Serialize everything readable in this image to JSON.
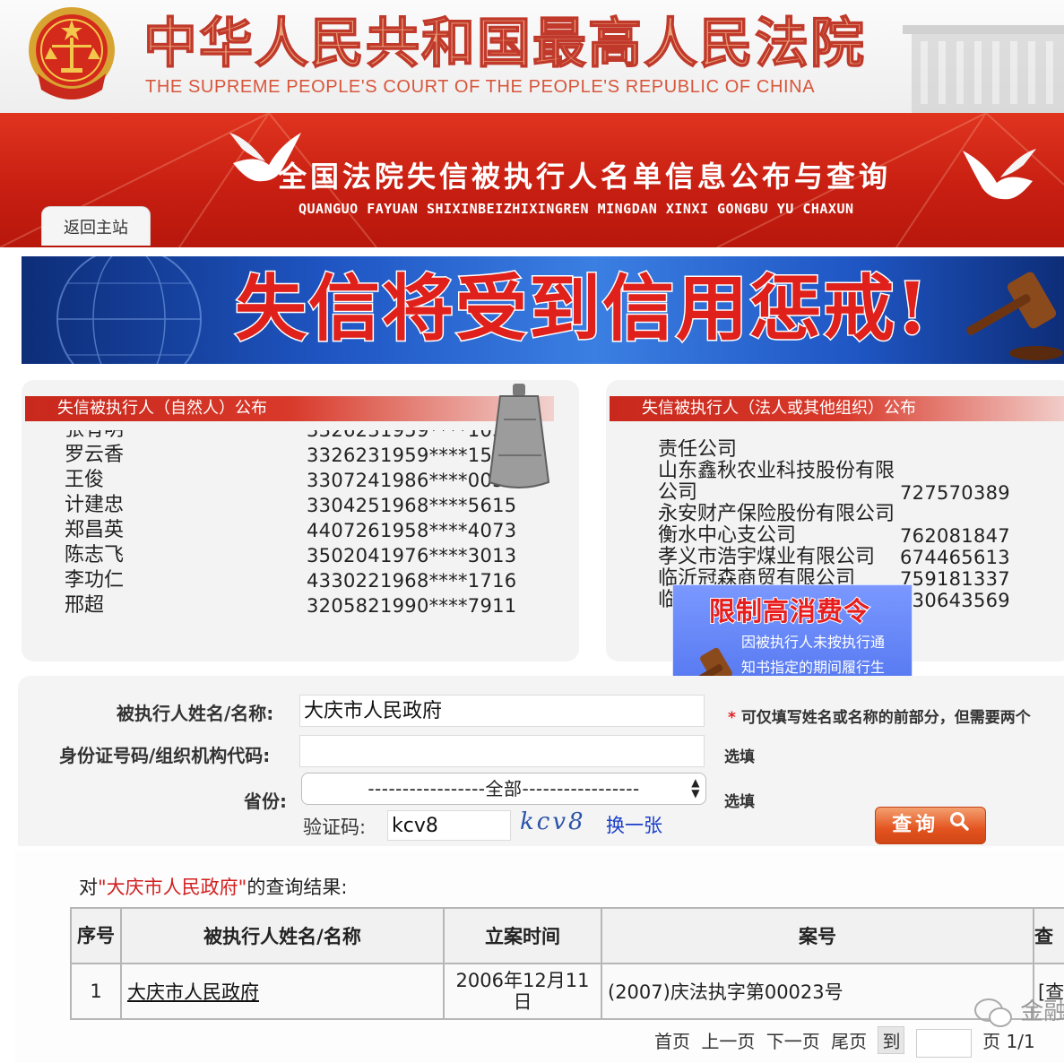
{
  "header": {
    "court_name_cn": "中华人民共和国最高人民法院",
    "court_name_en": "THE SUPREME PEOPLE'S COURT OF THE PEOPLE'S REPUBLIC OF CHINA",
    "system_title_cn": "全国法院失信被执行人名单信息公布与查询",
    "system_title_pinyin": "QUANGUO FAYUAN SHIXINBEIZHIXINGREN MINGDAN XINXI GONGBU YU CHAXUN",
    "back_home": "返回主站"
  },
  "banner": {
    "slogan": "失信将受到信用惩戒!"
  },
  "natural_persons": {
    "title": "失信被执行人（自然人）公布",
    "rows": [
      {
        "name": "罗云香",
        "id": "3326231959****1544"
      },
      {
        "name": "王俊",
        "id": "3307241986****005x"
      },
      {
        "name": "计建忠",
        "id": "3304251968****5615"
      },
      {
        "name": "郑昌英",
        "id": "4407261958****4073"
      },
      {
        "name": "陈志飞",
        "id": "3502041976****3013"
      },
      {
        "name": "李功仁",
        "id": "4330221968****1716"
      },
      {
        "name": "邢超",
        "id": "3205821990****7911"
      }
    ]
  },
  "legal_entities": {
    "title": "失信被执行人（法人或其他组织）公布",
    "rows": [
      {
        "name": "责任公司",
        "code": ""
      },
      {
        "name": "山东鑫秋农业科技股份有限公司",
        "code": "727570389"
      },
      {
        "name": "永安财产保险股份有限公司衡水中心支公司",
        "code": "762081847"
      },
      {
        "name": "孝义市浩宇煤业有限公司",
        "code": "674465613"
      },
      {
        "name": "临沂冠森商贸有限公司",
        "code": "759181337"
      },
      {
        "name": "临",
        "code": "330643569"
      }
    ]
  },
  "popup": {
    "title": "限制高消费令",
    "text": "因被执行人未按执行通\n知书指定的期间履行生\n效法律文书..."
  },
  "form": {
    "name_label": "被执行人姓名/名称:",
    "name_value": "大庆市人民政府",
    "name_hint": "可仅填写姓名或名称的前部分，但需要两个",
    "id_label": "身份证号码/组织机构代码:",
    "id_value": "",
    "id_hint": "选填",
    "province_label": "省份:",
    "province_value": "-----------------全部-----------------",
    "province_hint": "选填",
    "captcha_label": "验证码:",
    "captcha_value": "kcv8",
    "captcha_image_text": "kcv8",
    "refresh": "换一张",
    "search_button": "查询"
  },
  "results": {
    "caption_prefix": "对",
    "caption_query": "\"大庆市人民政府\"",
    "caption_suffix": "的查询结果:",
    "columns": [
      "序号",
      "被执行人姓名/名称",
      "立案时间",
      "案号",
      "查"
    ],
    "rows": [
      {
        "no": "1",
        "name": "大庆市人民政府",
        "date": "2006年12月11日",
        "case_no": "(2007)庆法执字第00023号",
        "action": "[查"
      }
    ],
    "pager": {
      "first": "首页",
      "prev": "上一页",
      "next": "下一页",
      "last": "尾页",
      "go": "到",
      "page_label": "页 1/1"
    }
  },
  "watermark": "金融"
}
